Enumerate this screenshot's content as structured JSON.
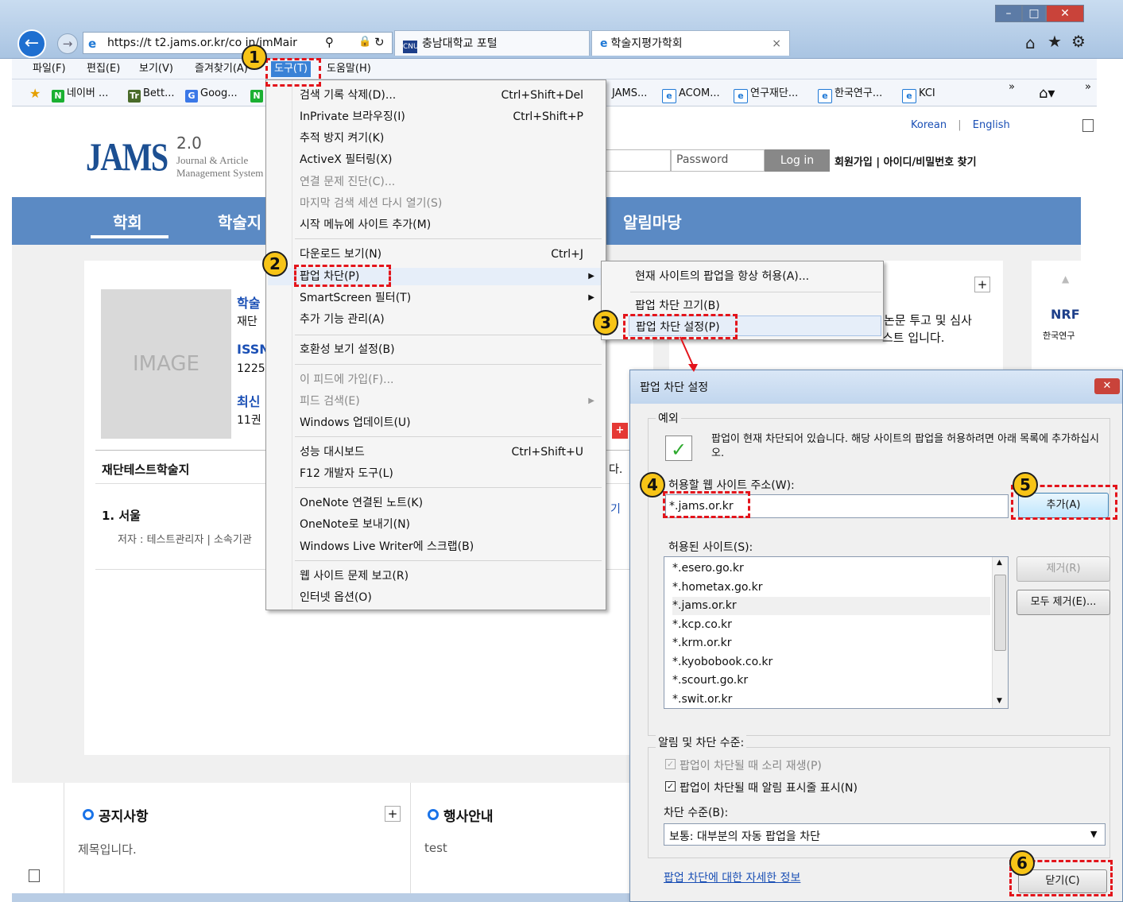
{
  "browser": {
    "url": "https://t  t2.jams.or.kr/co  in/jmMair",
    "tabs": [
      {
        "label": "충남대학교 포털"
      },
      {
        "label": "학술지평가학회"
      }
    ],
    "menu": [
      "파일(F)",
      "편집(E)",
      "보기(V)",
      "즐겨찾기(A)",
      "도구(T)",
      "도움말(H)"
    ],
    "favorites": [
      "네이버 ...",
      "Bett...",
      "Goog...",
      "JAMS...",
      "ACOM...",
      "연구재단...",
      "한국연구...",
      "KCI"
    ],
    "favicon_letters": {
      "naver": "N",
      "tr": "Tr",
      "g": "G"
    },
    "chevron": "»",
    "window_buttons": [
      "–",
      "□",
      "✕"
    ]
  },
  "page": {
    "lang": [
      "Korean",
      "|",
      "English"
    ],
    "logo": "JAMS",
    "logo_version": "2.0",
    "logo_sub1": "Journal & Article",
    "logo_sub2": "Management System",
    "password_placeholder": "Password",
    "login": "Log in",
    "links": "회원가입 | 아이디/비밀번호 찾기",
    "nav": [
      "학회",
      "학술지",
      "알림마당"
    ],
    "image_label": "IMAGE",
    "info_lines": [
      "학술",
      "재단",
      "ISSN",
      "1225",
      "최신",
      "11권"
    ],
    "journal_title": "재단테스트학술지",
    "list_item": "1. 서울",
    "list_author": "저자 : 테스트관리자 | 소속기관",
    "right_text1": "논문 투고 및 심사",
    "right_text2": "스트 입니다.",
    "right_frag": "다.",
    "more_frag": "기",
    "nrf": "NRF",
    "nrf_sub": "한국연구",
    "notice_title": "공지사항",
    "notice_item": "제목입니다.",
    "event_title": "행사안내",
    "event_item": "test",
    "plus": "+"
  },
  "tools_menu": [
    {
      "label": "검색 기록 삭제(D)...",
      "shortcut": "Ctrl+Shift+Del"
    },
    {
      "label": "InPrivate 브라우징(I)",
      "shortcut": "Ctrl+Shift+P"
    },
    {
      "label": "추적 방지 켜기(K)"
    },
    {
      "label": "ActiveX 필터링(X)"
    },
    {
      "label": "연결 문제 진단(C)...",
      "disabled": true
    },
    {
      "label": "마지막 검색 세션 다시 열기(S)",
      "disabled": true
    },
    {
      "label": "시작 메뉴에 사이트 추가(M)"
    },
    {
      "label": "다운로드 보기(N)",
      "shortcut": "Ctrl+J"
    },
    {
      "label": "팝업 차단(P)",
      "submenu": true
    },
    {
      "label": "SmartScreen 필터(T)",
      "submenu": true
    },
    {
      "label": "추가 기능 관리(A)"
    },
    {
      "label": "호환성 보기 설정(B)"
    },
    {
      "label": "이 피드에 가입(F)...",
      "disabled": true
    },
    {
      "label": "피드 검색(E)",
      "disabled": true,
      "submenu": true
    },
    {
      "label": "Windows 업데이트(U)"
    },
    {
      "label": "성능 대시보드",
      "shortcut": "Ctrl+Shift+U"
    },
    {
      "label": "F12 개발자 도구(L)"
    },
    {
      "label": "OneNote 연결된 노트(K)"
    },
    {
      "label": "OneNote로 보내기(N)"
    },
    {
      "label": "Windows Live Writer에 스크랩(B)"
    },
    {
      "label": "웹 사이트 문제 보고(R)"
    },
    {
      "label": "인터넷 옵션(O)"
    }
  ],
  "popup_submenu": [
    "현재 사이트의 팝업을 항상 허용(A)...",
    "팝업 차단 끄기(B)",
    "팝업 차단 설정(P)"
  ],
  "dialog": {
    "title": "팝업 차단 설정",
    "close": "✕",
    "exceptions_label": "예외",
    "info": "팝업이 현재 차단되어 있습니다. 해당 사이트의 팝업을 허용하려면 아래 목록에 추가하십시오.",
    "address_label": "허용할 웹 사이트 주소(W):",
    "address_value": "*.jams.or.kr",
    "add_button": "추가(A)",
    "allowed_label": "허용된 사이트(S):",
    "allowed_sites": [
      "*.esero.go.kr",
      "*.hometax.go.kr",
      "*.jams.or.kr",
      "*.kcp.co.kr",
      "*.krm.or.kr",
      "*.kyobobook.co.kr",
      "*.scourt.go.kr",
      "*.swit.or.kr"
    ],
    "remove_button": "제거(R)",
    "remove_all_button": "모두 제거(E)...",
    "notify_label": "알림 및 차단 수준:",
    "sound_checkbox": "팝업이 차단될 때 소리 재생(P)",
    "bar_checkbox": "팝업이 차단될 때 알림 표시줄 표시(N)",
    "level_label": "차단 수준(B):",
    "level_value": "보통: 대부분의 자동 팝업을 차단",
    "more_info_link": "팝업 차단에 대한 자세한 정보",
    "close_button": "닫기(C)"
  },
  "badges": [
    "1",
    "2",
    "3",
    "4",
    "5",
    "6"
  ],
  "colors": {
    "accent": "#5b8ac4",
    "highlight": "#e3141b",
    "badge": "#f7c417",
    "link": "#1a4fb5"
  }
}
